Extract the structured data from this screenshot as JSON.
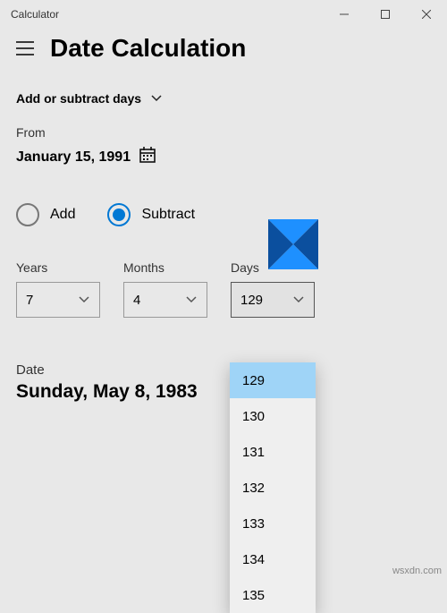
{
  "window": {
    "title": "Calculator"
  },
  "header": {
    "title": "Date Calculation"
  },
  "mode": {
    "label": "Add or subtract days"
  },
  "from": {
    "label": "From",
    "date": "January 15, 1991"
  },
  "radio": {
    "add_label": "Add",
    "subtract_label": "Subtract",
    "selected": "subtract"
  },
  "spinners": {
    "years": {
      "label": "Years",
      "value": "7"
    },
    "months": {
      "label": "Months",
      "value": "4"
    },
    "days": {
      "label": "Days",
      "value": "129"
    }
  },
  "dropdown": {
    "options": [
      "129",
      "130",
      "131",
      "132",
      "133",
      "134",
      "135"
    ],
    "selected_index": 0
  },
  "result": {
    "label": "Date",
    "value": "Sunday, May 8, 1983"
  },
  "watermark": "wsxdn.com"
}
